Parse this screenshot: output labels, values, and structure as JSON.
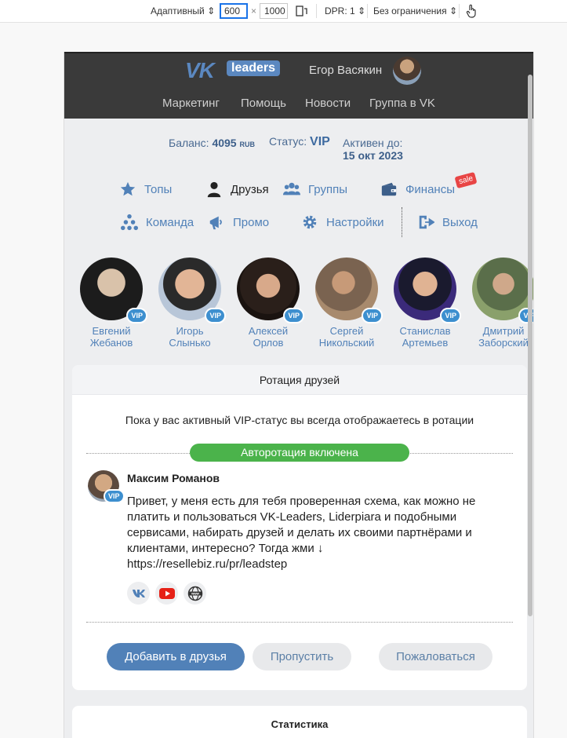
{
  "devtools": {
    "device": "Адаптивный",
    "width": "600",
    "height": "1000",
    "dpr": "DPR: 1",
    "throttle": "Без ограничения"
  },
  "header": {
    "logo_vk": "VK",
    "logo_badge": "leaders",
    "user_name": "Егор Васякин",
    "nav": [
      "Маркетинг",
      "Помощь",
      "Новости",
      "Группа в VK"
    ]
  },
  "status": {
    "balance_label": "Баланс:",
    "balance_value": "4095",
    "balance_currency": "RUB",
    "status_label": "Статус:",
    "status_value": "VIP",
    "active_label": "Активен до:",
    "active_value": "15 окт 2023"
  },
  "menu": {
    "row1": [
      "Топы",
      "Друзья",
      "Группы",
      "Финансы"
    ],
    "row2": [
      "Команда",
      "Промо",
      "Настройки",
      "Выход"
    ],
    "sale_badge": "sale"
  },
  "friends": [
    {
      "first": "Евгений",
      "last": "Жебанов",
      "badge": "VIP"
    },
    {
      "first": "Игорь",
      "last": "Слынько",
      "badge": "VIP"
    },
    {
      "first": "Алексей",
      "last": "Орлов",
      "badge": "VIP"
    },
    {
      "first": "Сергей",
      "last": "Никольский",
      "badge": "VIP"
    },
    {
      "first": "Станислав",
      "last": "Артемьев",
      "badge": "VIP"
    },
    {
      "first": "Дмитрий",
      "last": "Заборский",
      "badge": "VIP"
    }
  ],
  "rotation": {
    "title": "Ротация друзей",
    "info": "Пока у вас активный VIP-статус вы всегда отображаетесь в ротации",
    "autorotation": "Авторотация включена",
    "post": {
      "name": "Максим Романов",
      "badge": "VIP",
      "text": "Привет, у меня есть для тебя проверенная схема, как можно не платить и пользоваться VK-Leaders, Liderpiara и подобными сервисами, набирать друзей и делать их своими партнёрами и клиентами, интересно? Тогда жми ↓",
      "link": "https://resellebiz.ru/pr/leadstep"
    },
    "buttons": {
      "add": "Добавить в друзья",
      "skip": "Пропустить",
      "report": "Пожаловаться"
    }
  },
  "statistics": {
    "title": "Статистика"
  }
}
